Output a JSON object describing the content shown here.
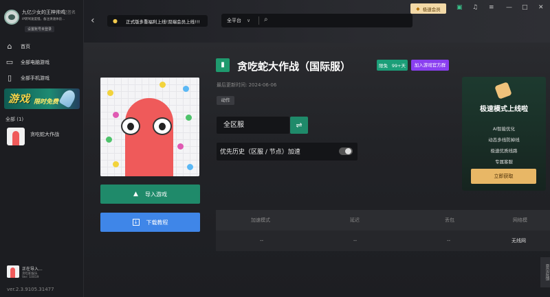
{
  "user": {
    "name": "九亿少女的王梓帅鸡",
    "tag": "已签名",
    "subtitle": "IP转驾速度慢，备注清速体验...",
    "tip": "设置账号未登录"
  },
  "nav": {
    "home": "首页",
    "pc_games": "全部电脑游戏",
    "mobile_games": "全部手机游戏"
  },
  "banner": {
    "line1": "游戏",
    "line2": "限时免费"
  },
  "category": {
    "title": "全部 (1)",
    "items": [
      {
        "name": "贪吃蛇大作战"
      }
    ]
  },
  "footer": {
    "game_name": "正在导入...",
    "game_sub1": "贪吃蛇娱乐",
    "game_sub2": "Ver: 10019",
    "version": "ver.2.3.9105.31477"
  },
  "topbar": {
    "notice": "正式版多重福利上线!双端会员上线!!!",
    "platform": "全平台",
    "vip_button": "极速会员"
  },
  "game": {
    "title": "贪吃蛇大作战（国际服）",
    "badge_free": "限免",
    "badge_days": "99+天",
    "group_button": "加入游戏官方群",
    "update_label": "最后更新时间:",
    "update_date": "2024-06-06",
    "genre": "动作",
    "server": "全区服",
    "priority": "优先历史（区服 / 节点）加速",
    "import_button": "导入游戏",
    "tutorial_button": "下载教程"
  },
  "promo": {
    "title": "极速模式上线啦",
    "features": [
      "AI智能优化",
      "动态多线防掉线",
      "极速优质线路",
      "专属客服"
    ],
    "button": "立即获取"
  },
  "table": {
    "headers": [
      "加速模式",
      "延迟",
      "丢包",
      "网络模"
    ],
    "values": [
      "--",
      "--",
      "--",
      "无线网"
    ]
  },
  "feedback": "意见反馈"
}
